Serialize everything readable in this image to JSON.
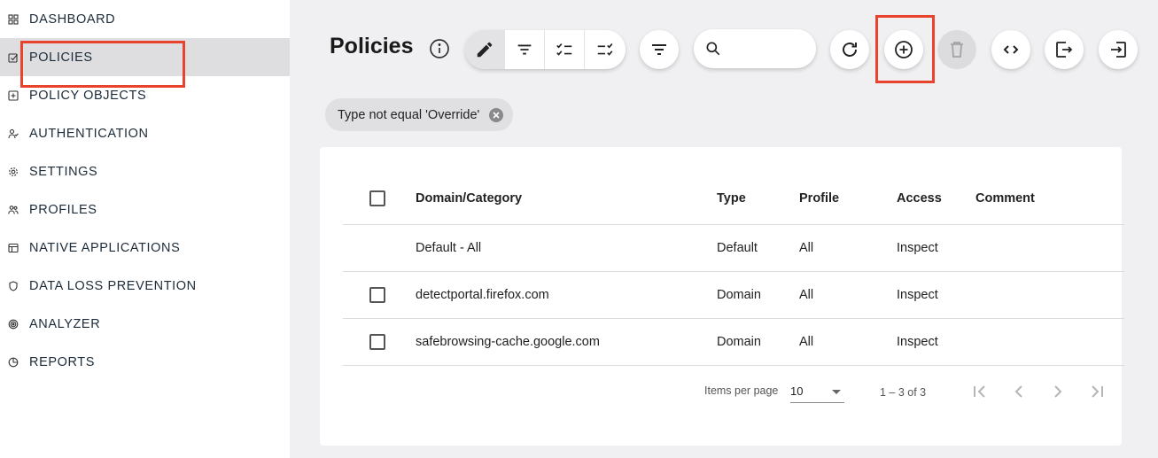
{
  "sidebar": {
    "items": [
      {
        "label": "DASHBOARD",
        "icon": "grid-icon"
      },
      {
        "label": "POLICIES",
        "icon": "checkbox-pen-icon"
      },
      {
        "label": "POLICY OBJECTS",
        "icon": "plus-square-icon"
      },
      {
        "label": "AUTHENTICATION",
        "icon": "user-check-icon"
      },
      {
        "label": "SETTINGS",
        "icon": "gear-icon"
      },
      {
        "label": "PROFILES",
        "icon": "users-icon"
      },
      {
        "label": "NATIVE APPLICATIONS",
        "icon": "app-window-icon"
      },
      {
        "label": "DATA LOSS PREVENTION",
        "icon": "shield-icon"
      },
      {
        "label": "ANALYZER",
        "icon": "target-icon"
      },
      {
        "label": "REPORTS",
        "icon": "pie-chart-icon"
      }
    ],
    "active_index": 1
  },
  "header": {
    "title": "Policies",
    "search": {
      "value": "",
      "placeholder": ""
    }
  },
  "filter_chip": {
    "label": "Type not equal 'Override'"
  },
  "table": {
    "columns": [
      "Domain/Category",
      "Type",
      "Profile",
      "Access",
      "Comment"
    ],
    "rows": [
      {
        "domain": "Default - All",
        "type": "Default",
        "profile": "All",
        "access": "Inspect",
        "comment": "",
        "has_checkbox": false
      },
      {
        "domain": "detectportal.firefox.com",
        "type": "Domain",
        "profile": "All",
        "access": "Inspect",
        "comment": "",
        "has_checkbox": true
      },
      {
        "domain": "safebrowsing-cache.google.com",
        "type": "Domain",
        "profile": "All",
        "access": "Inspect",
        "comment": "",
        "has_checkbox": true
      }
    ]
  },
  "paginator": {
    "items_per_page_label": "Items per page",
    "items_per_page_value": "10",
    "range_label": "1 – 3 of 3"
  },
  "colors": {
    "highlight": "#e8432d",
    "active_nav": "#dedee0",
    "background": "#f0f0f2"
  }
}
